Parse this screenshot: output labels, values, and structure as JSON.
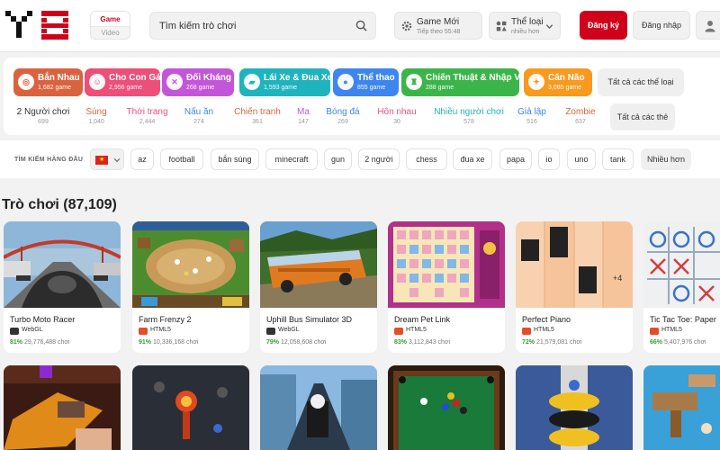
{
  "header": {
    "game_tab": "Game",
    "video_tab": "Video",
    "search_placeholder": "Tìm kiếm trò chơi",
    "new_games_label": "Game Mới",
    "new_games_sub": "Tiếp theo 55:48",
    "categories_label": "Thể loại",
    "categories_sub": "nhiều hơn",
    "register_label": "Đăng ký",
    "login_label": "Đăng nhập"
  },
  "categories": [
    {
      "name": "Bắn Nhau",
      "count": "1,682 game",
      "color": "#d9633f",
      "icon": "target-icon",
      "glyph": "◎"
    },
    {
      "name": "Cho Con Gái",
      "count": "2,956 game",
      "color": "#ec4f79",
      "icon": "face-icon",
      "glyph": "☺"
    },
    {
      "name": "Đối Kháng",
      "count": "268 game",
      "color": "#c356d8",
      "icon": "swords-icon",
      "glyph": "✕"
    },
    {
      "name": "Lái Xe & Đua Xe",
      "count": "1,593 game",
      "color": "#1fb4bd",
      "icon": "car-icon",
      "glyph": "▰"
    },
    {
      "name": "Thể thao",
      "count": "855 game",
      "color": "#3d86ee",
      "icon": "ball-icon",
      "glyph": "●"
    },
    {
      "name": "Chiến Thuật & Nhập Vai",
      "count": "288 game",
      "color": "#3bb54a",
      "icon": "chess-icon",
      "glyph": "♜"
    },
    {
      "name": "Căn Não",
      "count": "3,085 game",
      "color": "#f79a1d",
      "icon": "bulb-icon",
      "glyph": "✦"
    }
  ],
  "all_categories_label": "Tất cả các thể loại",
  "subcategories": [
    {
      "name": "2 Người chơi",
      "count": "699",
      "color": "#333333"
    },
    {
      "name": "Súng",
      "count": "1,040",
      "color": "#d9633f"
    },
    {
      "name": "Thời trang",
      "count": "2,444",
      "color": "#ec4f79"
    },
    {
      "name": "Nấu ăn",
      "count": "274",
      "color": "#3d86ee"
    },
    {
      "name": "Chiến tranh",
      "count": "361",
      "color": "#d9633f"
    },
    {
      "name": "Ma",
      "count": "147",
      "color": "#c356d8"
    },
    {
      "name": "Bóng đá",
      "count": "269",
      "color": "#3d86ee"
    },
    {
      "name": "Hôn nhau",
      "count": "30",
      "color": "#ec4f79"
    },
    {
      "name": "Nhiều người chơi",
      "count": "578",
      "color": "#1fb4bd"
    },
    {
      "name": "Giả lập",
      "count": "516",
      "color": "#3d86ee"
    },
    {
      "name": "Zombie",
      "count": "637",
      "color": "#d9633f"
    }
  ],
  "all_sub_label": "Tất cả các thẻ",
  "top_searches": {
    "label": "TÌM KIẾM HÀNG ĐẦU",
    "tags": [
      "az",
      "football",
      "bắn súng",
      "minecraft",
      "gun",
      "2 người",
      "chess",
      "đua xe",
      "papa",
      "io",
      "uno",
      "tank"
    ],
    "more_label": "Nhiều hơn"
  },
  "games_title": "Trò chơi (87,109)",
  "games": [
    {
      "name": "Turbo Moto Racer",
      "tech": "WebGL",
      "percent": "81%",
      "plays": "29,776,488 chơi"
    },
    {
      "name": "Farm Frenzy 2",
      "tech": "HTML5",
      "percent": "91%",
      "plays": "10,336,168 chơi"
    },
    {
      "name": "Uphill Bus Simulator 3D",
      "tech": "WebGL",
      "percent": "79%",
      "plays": "12,058,608 chơi"
    },
    {
      "name": "Dream Pet Link",
      "tech": "HTML5",
      "percent": "83%",
      "plays": "3,112,843 chơi"
    },
    {
      "name": "Perfect Piano",
      "tech": "HTML5",
      "percent": "72%",
      "plays": "21,579,081 chơi"
    },
    {
      "name": "Tic Tac Toe: Paper",
      "tech": "HTML5",
      "percent": "66%",
      "plays": "5,407,976 chơi"
    }
  ],
  "thumb_texts": {
    "piano_score": "+4"
  },
  "colors": {
    "brand_red": "#d0021b",
    "rating_green": "#3a9a3a",
    "webgl": "#333333",
    "html5": "#e44d26"
  }
}
